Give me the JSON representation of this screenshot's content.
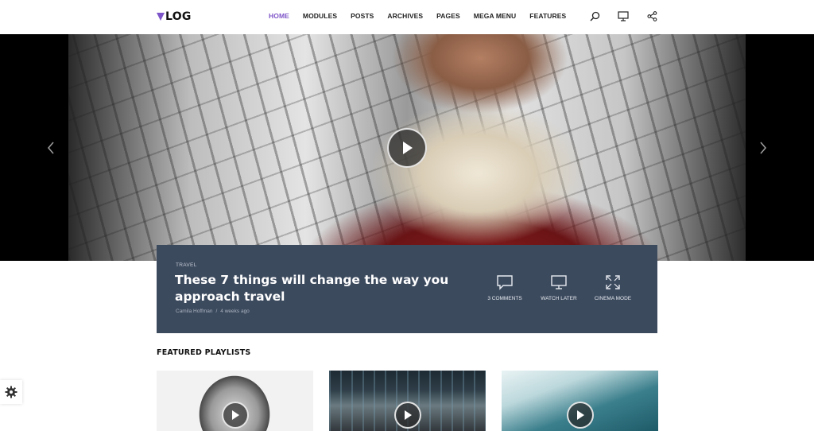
{
  "header": {
    "logo_text": "LOG",
    "logo_accent": "#7e55c8",
    "nav": [
      {
        "label": "HOME",
        "active": true
      },
      {
        "label": "MODULES"
      },
      {
        "label": "POSTS"
      },
      {
        "label": "ARCHIVES"
      },
      {
        "label": "PAGES"
      },
      {
        "label": "MEGA MENU"
      },
      {
        "label": "FEATURES"
      }
    ],
    "icons": [
      "search-icon",
      "monitor-icon",
      "share-icon"
    ]
  },
  "hero": {
    "play_icon": "play-icon",
    "prev_icon": "chevron-left-icon",
    "next_icon": "chevron-right-icon"
  },
  "post": {
    "category": "TRAVEL",
    "title": "These 7 things will change the way you approach travel",
    "author": "Camila Hoffman",
    "separator": "/",
    "date": "4 weeks ago",
    "actions": [
      {
        "icon": "comment-icon",
        "label": "3 COMMENTS"
      },
      {
        "icon": "monitor-icon",
        "label": "WATCH LATER"
      },
      {
        "icon": "expand-icon",
        "label": "CINEMA MODE"
      }
    ],
    "background": "#3c4a5e"
  },
  "featured": {
    "title": "FEATURED PLAYLISTS",
    "thumbnails": [
      "portrait",
      "subway",
      "surfer"
    ]
  },
  "settings_icon": "gear-icon"
}
